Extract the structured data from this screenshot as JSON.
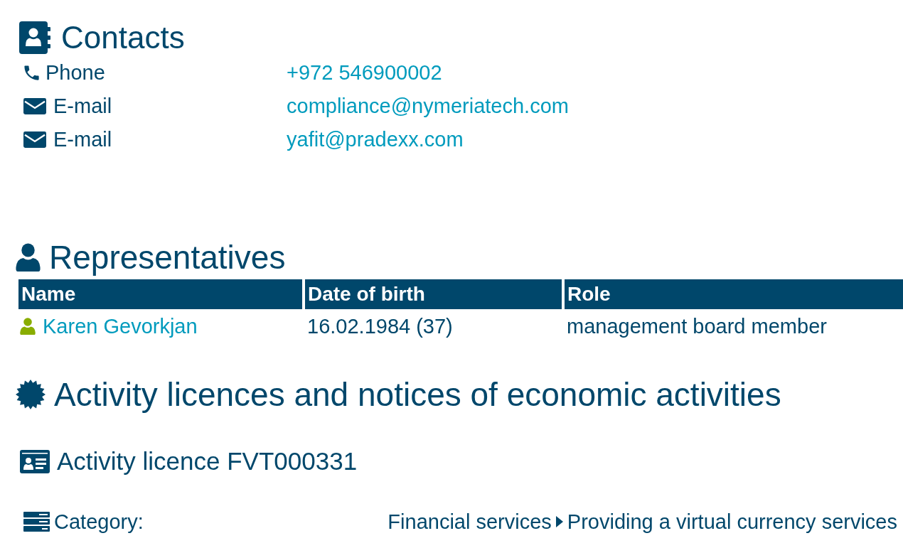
{
  "contacts": {
    "title": "Contacts",
    "items": [
      {
        "kind": "phone",
        "label": "Phone",
        "value": "+972 546900002"
      },
      {
        "kind": "email",
        "label": "E-mail",
        "value": "compliance@nymeriatech.com"
      },
      {
        "kind": "email",
        "label": "E-mail",
        "value": "yafit@pradexx.com"
      }
    ]
  },
  "representatives": {
    "title": "Representatives",
    "table": {
      "columns": [
        "Name",
        "Date of birth",
        "Role"
      ],
      "rows": [
        {
          "name": "Karen Gevorkjan",
          "date_of_birth": "16.02.1984 (37)",
          "role": "management board member"
        }
      ]
    }
  },
  "activity": {
    "title": "Activity licences and notices of economic activities",
    "licences": [
      {
        "title": "Activity licence FVT000331",
        "fields": [
          {
            "kind": "category",
            "label": "Category:",
            "path": [
              "Financial services",
              "Providing a virtual currency services"
            ]
          }
        ]
      }
    ]
  }
}
